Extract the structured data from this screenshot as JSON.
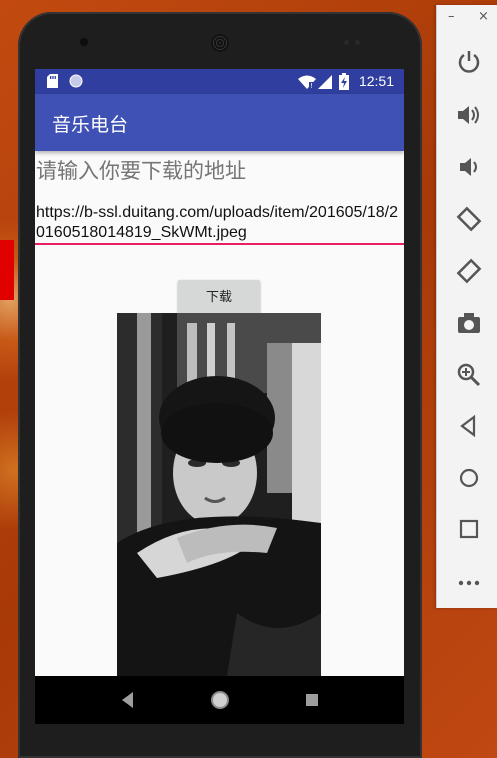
{
  "statusbar": {
    "time": "12:51"
  },
  "app": {
    "title": "音乐电台"
  },
  "form": {
    "prompt": "请输入你要下载的地址",
    "url_value": "https://b-ssl.duitang.com/uploads/item/201605/18/20160518014819_SkWMt.jpeg",
    "download_label": "下载"
  },
  "emulator_toolbar": {
    "minimize": "–",
    "close": "×",
    "items": [
      "power-icon",
      "volume-up-icon",
      "volume-down-icon",
      "rotate-left-icon",
      "rotate-right-icon",
      "camera-icon",
      "zoom-icon",
      "back-icon",
      "home-icon",
      "overview-icon",
      "more-icon"
    ]
  },
  "colors": {
    "primary_dark": "#303f9f",
    "primary": "#3f51b5",
    "accent": "#e91e63"
  }
}
